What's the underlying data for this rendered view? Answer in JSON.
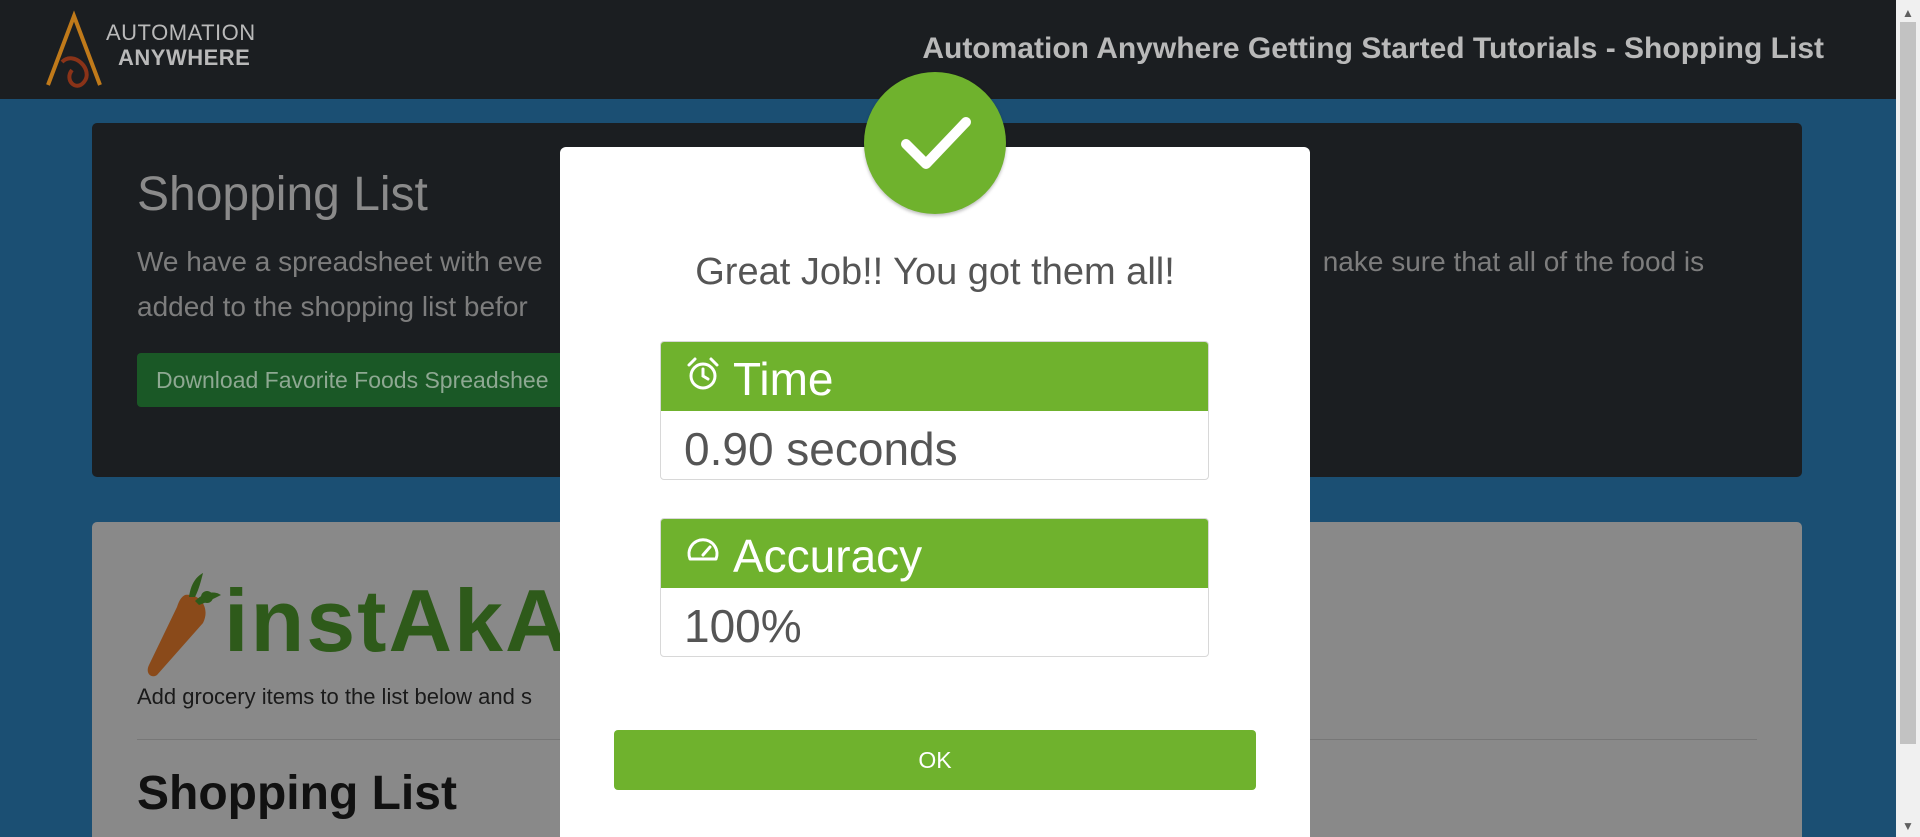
{
  "topbar": {
    "logo_line1": "AUTOMATION",
    "logo_line2": "ANYWHERE",
    "title": "Automation Anywhere Getting Started Tutorials - Shopping List"
  },
  "hero": {
    "title": "Shopping List",
    "description": "We have a spreadsheet with eve                                                                    nake sure that all of the food is added to the shopping list befor",
    "desc_line1_left": "We have a spreadsheet with eve",
    "desc_line1_right": "nake sure that all of the food is",
    "desc_line2": "added to the shopping list befor",
    "download_button": "Download Favorite Foods Spreadshee"
  },
  "card": {
    "brand": "instAkArt",
    "description": "Add grocery items to the list below and s",
    "heading": "Shopping List"
  },
  "modal": {
    "title": "Great Job!! You got them all!",
    "time_label": "Time",
    "time_value": "0.90 seconds",
    "accuracy_label": "Accuracy",
    "accuracy_value": "100%",
    "ok_button": "OK"
  },
  "colors": {
    "accent_green": "#6fb22d",
    "topbar_bg": "#1b1e21",
    "page_bg": "#1b4f73"
  },
  "icons": {
    "check": "check-icon",
    "time": "alarm-clock-icon",
    "accuracy": "speedometer-icon"
  }
}
